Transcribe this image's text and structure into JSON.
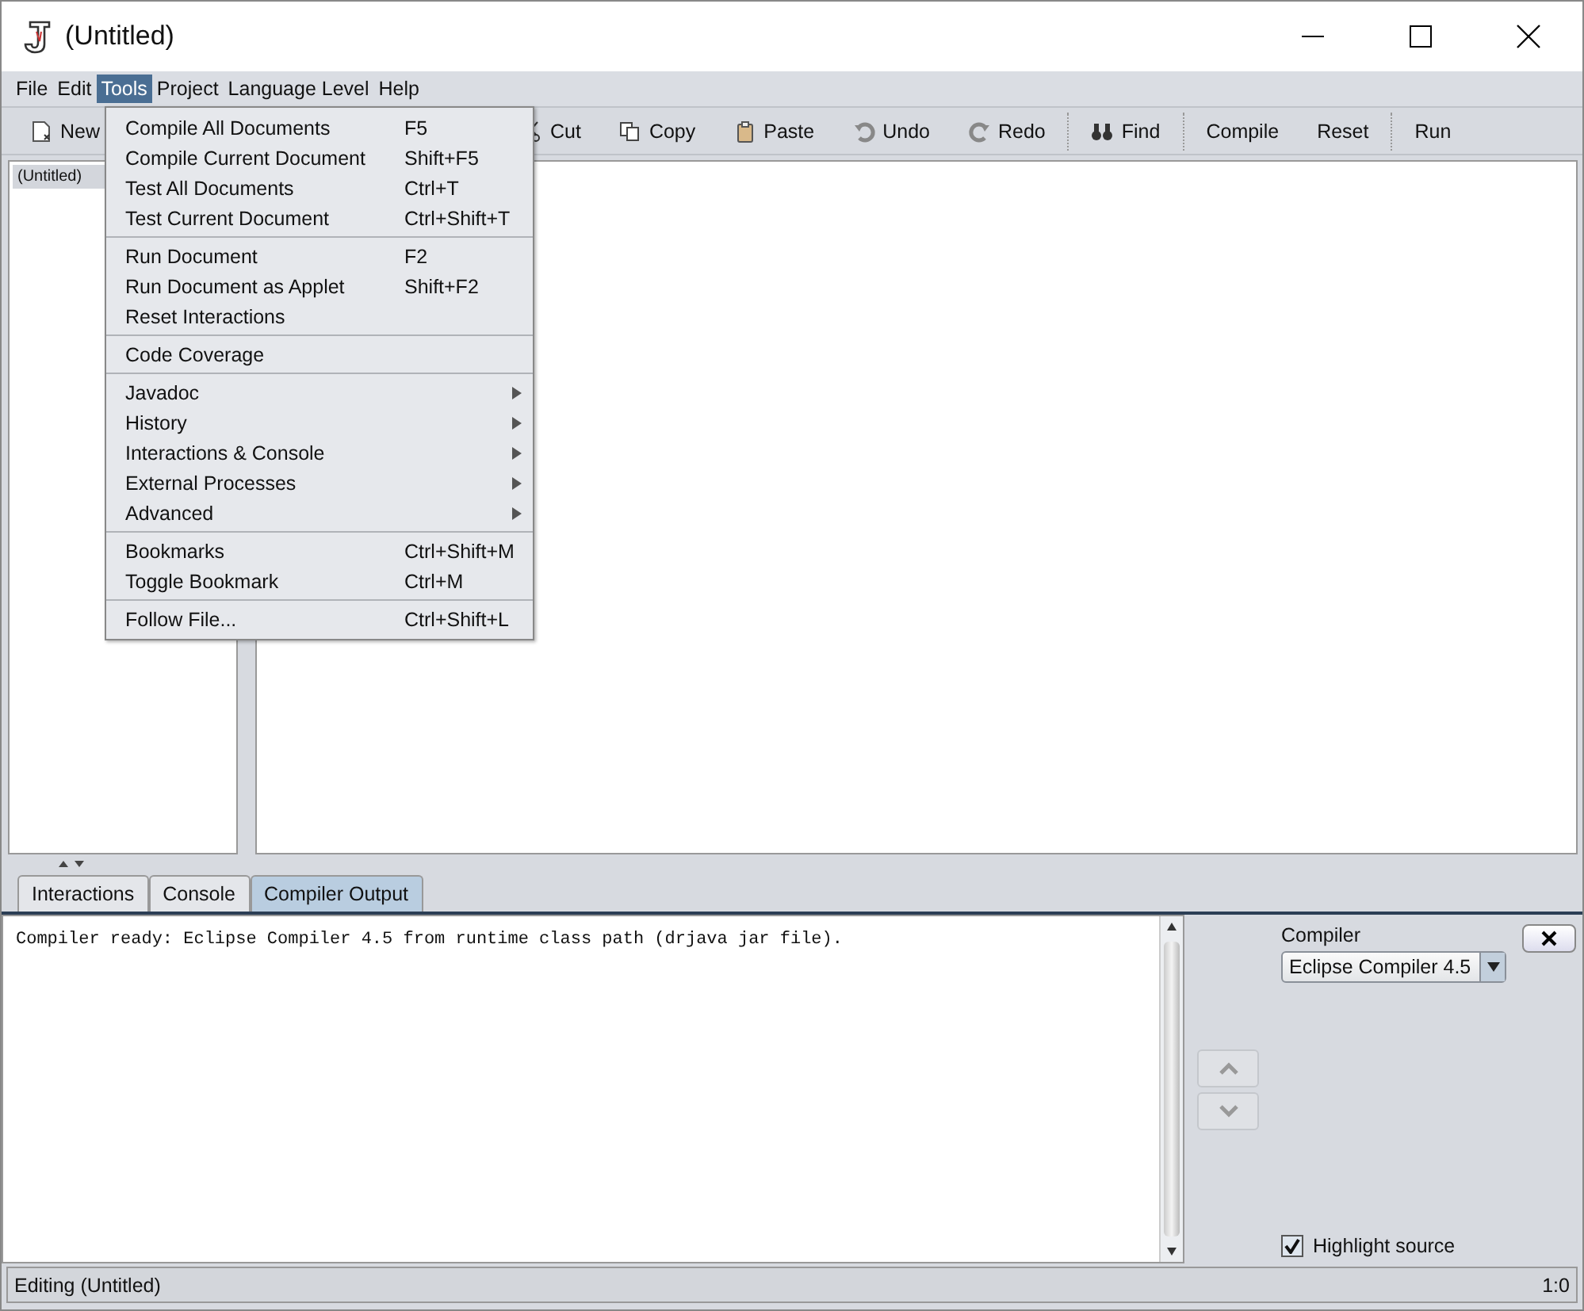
{
  "window": {
    "title": "(Untitled)"
  },
  "menu_bar": [
    {
      "label": "File",
      "selected": false
    },
    {
      "label": "Edit",
      "selected": false
    },
    {
      "label": "Tools",
      "selected": true
    },
    {
      "label": "Project",
      "selected": false
    },
    {
      "label": "Language Level",
      "selected": false
    },
    {
      "label": "Help",
      "selected": false
    }
  ],
  "toolbar": [
    [
      {
        "label": "New"
      }
    ],
    [
      {
        "label": "Cut"
      },
      {
        "label": "Copy"
      },
      {
        "label": "Paste"
      },
      {
        "label": "Undo"
      },
      {
        "label": "Redo"
      }
    ],
    [
      {
        "label": "Find"
      }
    ],
    [
      {
        "label": "Compile"
      },
      {
        "label": "Reset"
      }
    ],
    [
      {
        "label": "Run"
      }
    ]
  ],
  "documents": [
    {
      "label": "(Untitled)",
      "selected": true
    }
  ],
  "tools_menu": [
    [
      {
        "label": "Compile All Documents",
        "shortcut": "F5",
        "kind": "command"
      },
      {
        "label": "Compile Current Document",
        "shortcut": "Shift+F5",
        "kind": "command"
      },
      {
        "label": "Test All Documents",
        "shortcut": "Ctrl+T",
        "kind": "command"
      },
      {
        "label": "Test Current Document",
        "shortcut": "Ctrl+Shift+T",
        "kind": "command"
      }
    ],
    [
      {
        "label": "Run Document",
        "shortcut": "F2",
        "kind": "command"
      },
      {
        "label": "Run Document as Applet",
        "shortcut": "Shift+F2",
        "kind": "command"
      },
      {
        "label": "Reset Interactions",
        "kind": "command"
      }
    ],
    [
      {
        "label": "Code Coverage",
        "kind": "command"
      }
    ],
    [
      {
        "label": "Javadoc",
        "kind": "submenu"
      },
      {
        "label": "History",
        "kind": "submenu"
      },
      {
        "label": "Interactions & Console",
        "kind": "submenu"
      },
      {
        "label": "External Processes",
        "kind": "submenu"
      },
      {
        "label": "Advanced",
        "kind": "submenu"
      }
    ],
    [
      {
        "label": "Bookmarks",
        "shortcut": "Ctrl+Shift+M",
        "kind": "command"
      },
      {
        "label": "Toggle Bookmark",
        "shortcut": "Ctrl+M",
        "kind": "command"
      }
    ],
    [
      {
        "label": "Follow File...",
        "shortcut": "Ctrl+Shift+L",
        "kind": "command"
      }
    ]
  ],
  "tabs": [
    {
      "label": "Interactions",
      "selected": false
    },
    {
      "label": "Console",
      "selected": false
    },
    {
      "label": "Compiler Output",
      "selected": true
    }
  ],
  "output": "Compiler ready: Eclipse Compiler 4.5 from runtime class path (drjava jar file).",
  "compiler_panel": {
    "label": "Compiler",
    "value": "Eclipse Compiler 4.5",
    "highlight_label": "Highlight source",
    "highlight_checked": true
  },
  "status_bar": {
    "text": "Editing (Untitled)",
    "position": "1:0"
  }
}
